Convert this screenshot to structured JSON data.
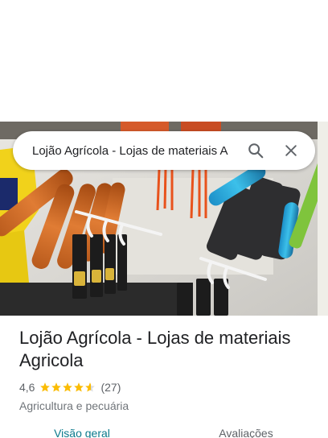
{
  "search": {
    "query": "Lojão Agrícola - Lojas de materiais A"
  },
  "place": {
    "title": "Lojão Agrícola - Lojas de materiais Agricola",
    "rating": "4,6",
    "rating_fraction": 0.92,
    "review_count": "(27)",
    "category": "Agricultura e pecuária"
  },
  "tabs": [
    {
      "label": "Visão geral",
      "active": true
    },
    {
      "label": "Avaliações",
      "active": false
    }
  ],
  "icons": {
    "search": "search-icon",
    "close": "close-icon",
    "star": "star-icon"
  },
  "colors": {
    "star": "#fbbc04",
    "active_tab": "#0b7a8c",
    "text": "#202124"
  }
}
